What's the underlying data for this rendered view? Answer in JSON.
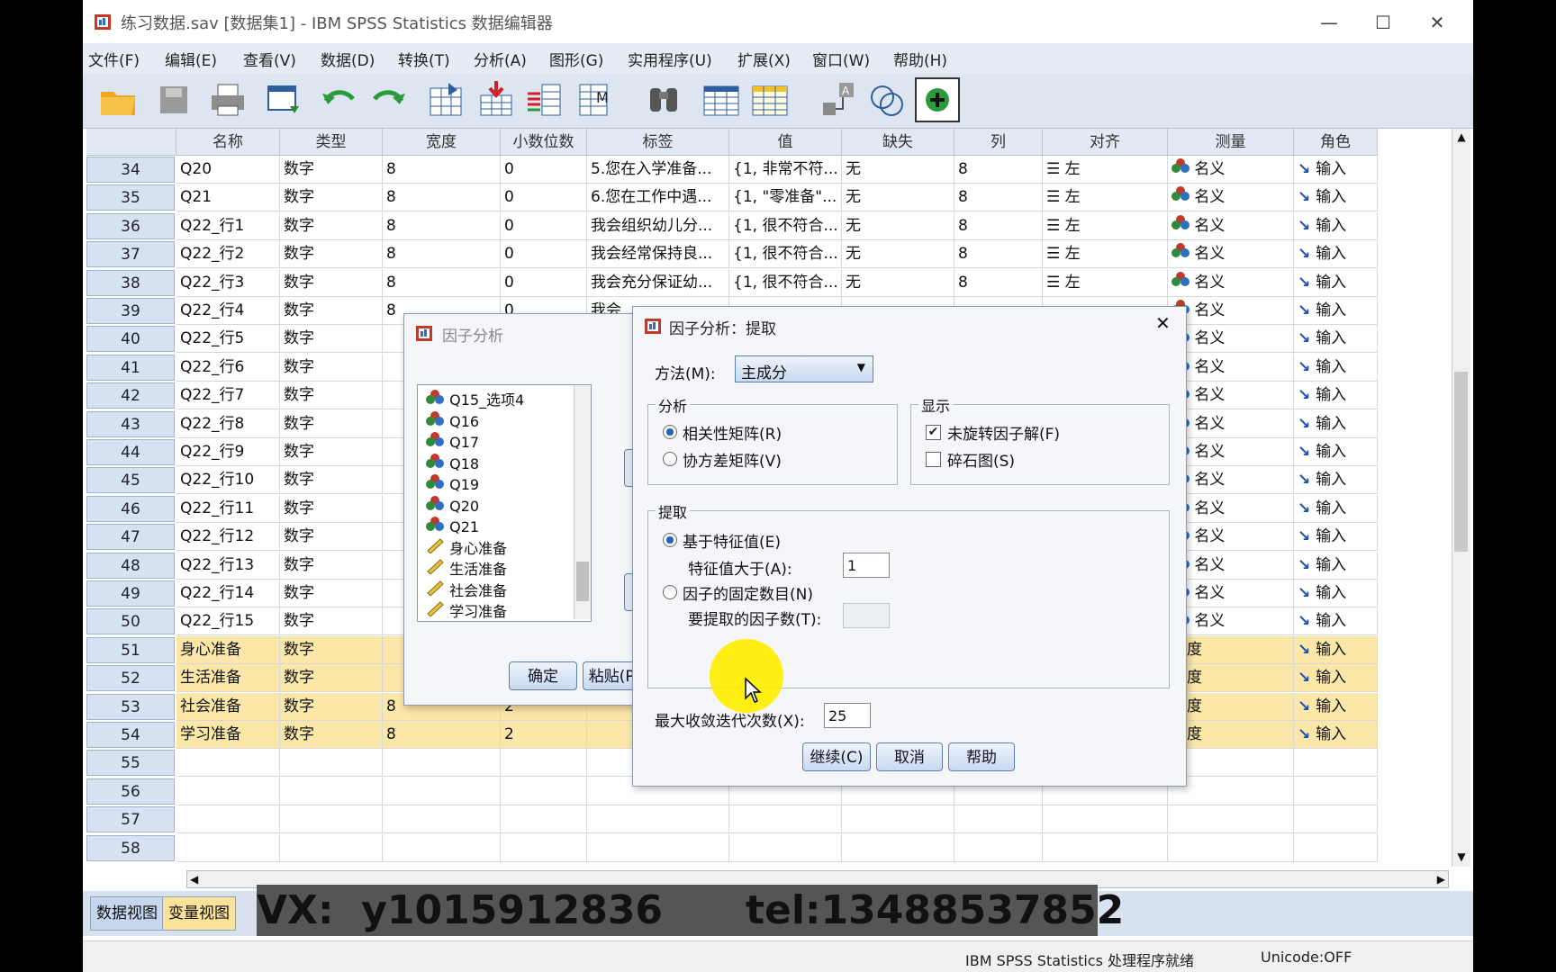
{
  "window": {
    "title": "练习数据.sav [数据集1] - IBM SPSS Statistics 数据编辑器",
    "controls": [
      "—",
      "☐",
      "✕"
    ]
  },
  "menu": [
    "文件(F)",
    "编辑(E)",
    "查看(V)",
    "数据(D)",
    "转换(T)",
    "分析(A)",
    "图形(G)",
    "实用程序(U)",
    "扩展(X)",
    "窗口(W)",
    "帮助(H)"
  ],
  "toolbar": [
    "open-icon",
    "save-icon",
    "print-icon",
    "recall-dialog-icon",
    "undo-icon",
    "redo-icon",
    "goto-case-icon",
    "goto-variable-icon",
    "variables-icon",
    "value-labels-icon",
    "find-icon",
    "insert-cases-icon",
    "insert-variable-icon",
    "split-file-icon",
    "weight-cases-icon",
    "use-sets-icon"
  ],
  "grid": {
    "headers": [
      "名称",
      "类型",
      "宽度",
      "小数位数",
      "标签",
      "值",
      "缺失",
      "列",
      "对齐",
      "测量",
      "角色"
    ],
    "rows": [
      {
        "n": "34",
        "name": "Q20",
        "type": "数字",
        "width": "8",
        "dec": "0",
        "label": "5.您在入学准备...",
        "values": "{1, 非常不符...",
        "missing": "无",
        "cols": "8",
        "align": "左",
        "measure": "名义",
        "role": "输入",
        "hl": false
      },
      {
        "n": "35",
        "name": "Q21",
        "type": "数字",
        "width": "8",
        "dec": "0",
        "label": "6.您在工作中遇...",
        "values": "{1, \"零准备\"...",
        "missing": "无",
        "cols": "8",
        "align": "左",
        "measure": "名义",
        "role": "输入",
        "hl": false
      },
      {
        "n": "36",
        "name": "Q22_行1",
        "type": "数字",
        "width": "8",
        "dec": "0",
        "label": "我会组织幼儿分...",
        "values": "{1, 很不符合...",
        "missing": "无",
        "cols": "8",
        "align": "左",
        "measure": "名义",
        "role": "输入",
        "hl": false
      },
      {
        "n": "37",
        "name": "Q22_行2",
        "type": "数字",
        "width": "8",
        "dec": "0",
        "label": "我会经常保持良...",
        "values": "{1, 很不符合...",
        "missing": "无",
        "cols": "8",
        "align": "左",
        "measure": "名义",
        "role": "输入",
        "hl": false
      },
      {
        "n": "38",
        "name": "Q22_行3",
        "type": "数字",
        "width": "8",
        "dec": "0",
        "label": "我会充分保证幼...",
        "values": "{1, 很不符合...",
        "missing": "无",
        "cols": "8",
        "align": "左",
        "measure": "名义",
        "role": "输入",
        "hl": false
      },
      {
        "n": "39",
        "name": "Q22_行4",
        "type": "数字",
        "width": "8",
        "dec": "0",
        "label": "我会",
        "values": "",
        "missing": "",
        "cols": "",
        "align": "",
        "measure": "名义",
        "role": "输入",
        "hl": false
      },
      {
        "n": "40",
        "name": "Q22_行5",
        "type": "数字",
        "width": "",
        "dec": "",
        "label": "",
        "values": "",
        "missing": "",
        "cols": "",
        "align": "",
        "measure": "名义",
        "role": "输入",
        "hl": false
      },
      {
        "n": "41",
        "name": "Q22_行6",
        "type": "数字",
        "width": "",
        "dec": "",
        "label": "",
        "values": "",
        "missing": "",
        "cols": "",
        "align": "",
        "measure": "名义",
        "role": "输入",
        "hl": false
      },
      {
        "n": "42",
        "name": "Q22_行7",
        "type": "数字",
        "width": "",
        "dec": "",
        "label": "",
        "values": "",
        "missing": "",
        "cols": "",
        "align": "",
        "measure": "名义",
        "role": "输入",
        "hl": false
      },
      {
        "n": "43",
        "name": "Q22_行8",
        "type": "数字",
        "width": "",
        "dec": "",
        "label": "",
        "values": "",
        "missing": "",
        "cols": "",
        "align": "",
        "measure": "名义",
        "role": "输入",
        "hl": false
      },
      {
        "n": "44",
        "name": "Q22_行9",
        "type": "数字",
        "width": "",
        "dec": "",
        "label": "",
        "values": "",
        "missing": "",
        "cols": "",
        "align": "",
        "measure": "名义",
        "role": "输入",
        "hl": false
      },
      {
        "n": "45",
        "name": "Q22_行10",
        "type": "数字",
        "width": "",
        "dec": "",
        "label": "",
        "values": "",
        "missing": "",
        "cols": "",
        "align": "",
        "measure": "名义",
        "role": "输入",
        "hl": false
      },
      {
        "n": "46",
        "name": "Q22_行11",
        "type": "数字",
        "width": "",
        "dec": "",
        "label": "",
        "values": "",
        "missing": "",
        "cols": "",
        "align": "",
        "measure": "名义",
        "role": "输入",
        "hl": false
      },
      {
        "n": "47",
        "name": "Q22_行12",
        "type": "数字",
        "width": "",
        "dec": "",
        "label": "",
        "values": "",
        "missing": "",
        "cols": "",
        "align": "",
        "measure": "名义",
        "role": "输入",
        "hl": false
      },
      {
        "n": "48",
        "name": "Q22_行13",
        "type": "数字",
        "width": "",
        "dec": "",
        "label": "",
        "values": "",
        "missing": "",
        "cols": "",
        "align": "",
        "measure": "名义",
        "role": "输入",
        "hl": false
      },
      {
        "n": "49",
        "name": "Q22_行14",
        "type": "数字",
        "width": "",
        "dec": "",
        "label": "",
        "values": "",
        "missing": "",
        "cols": "",
        "align": "",
        "measure": "名义",
        "role": "输入",
        "hl": false
      },
      {
        "n": "50",
        "name": "Q22_行15",
        "type": "数字",
        "width": "",
        "dec": "",
        "label": "",
        "values": "",
        "missing": "",
        "cols": "",
        "align": "",
        "measure": "名义",
        "role": "输入",
        "hl": false
      },
      {
        "n": "51",
        "name": "身心准备",
        "type": "数字",
        "width": "",
        "dec": "",
        "label": "",
        "values": "",
        "missing": "",
        "cols": "",
        "align": "",
        "measure": "标度",
        "role": "输入",
        "hl": true
      },
      {
        "n": "52",
        "name": "生活准备",
        "type": "数字",
        "width": "",
        "dec": "",
        "label": "",
        "values": "",
        "missing": "",
        "cols": "",
        "align": "",
        "measure": "标度",
        "role": "输入",
        "hl": true
      },
      {
        "n": "53",
        "name": "社会准备",
        "type": "数字",
        "width": "8",
        "dec": "2",
        "label": "",
        "values": "",
        "missing": "",
        "cols": "",
        "align": "",
        "measure": "标度",
        "role": "输入",
        "hl": true
      },
      {
        "n": "54",
        "name": "学习准备",
        "type": "数字",
        "width": "8",
        "dec": "2",
        "label": "",
        "values": "",
        "missing": "",
        "cols": "",
        "align": "",
        "measure": "标度",
        "role": "输入",
        "hl": true
      },
      {
        "n": "55",
        "name": "",
        "type": "",
        "width": "",
        "dec": "",
        "label": "",
        "values": "",
        "missing": "",
        "cols": "",
        "align": "",
        "measure": "",
        "role": "",
        "hl": false
      },
      {
        "n": "56",
        "name": "",
        "type": "",
        "width": "",
        "dec": "",
        "label": "",
        "values": "",
        "missing": "",
        "cols": "",
        "align": "",
        "measure": "",
        "role": "",
        "hl": false
      },
      {
        "n": "57",
        "name": "",
        "type": "",
        "width": "",
        "dec": "",
        "label": "",
        "values": "",
        "missing": "",
        "cols": "",
        "align": "",
        "measure": "",
        "role": "",
        "hl": false
      },
      {
        "n": "58",
        "name": "",
        "type": "",
        "width": "",
        "dec": "",
        "label": "",
        "values": "",
        "missing": "",
        "cols": "",
        "align": "",
        "measure": "",
        "role": "",
        "hl": false
      }
    ]
  },
  "tabs": {
    "data_view": "数据视图",
    "variable_view": "变量视图"
  },
  "watermark": "VX:  y1015912836      tel:13488537852",
  "status": {
    "processor": "IBM SPSS Statistics 处理程序就绪",
    "unicode": "Unicode:OFF"
  },
  "factor_dialog": {
    "title": "因子分析",
    "list": [
      {
        "label": "Q15_选项4",
        "kind": "nominal"
      },
      {
        "label": "Q16",
        "kind": "nominal"
      },
      {
        "label": "Q17",
        "kind": "nominal"
      },
      {
        "label": "Q18",
        "kind": "nominal"
      },
      {
        "label": "Q19",
        "kind": "nominal"
      },
      {
        "label": "Q20",
        "kind": "nominal"
      },
      {
        "label": "Q21",
        "kind": "nominal"
      },
      {
        "label": "身心准备",
        "kind": "scale"
      },
      {
        "label": "生活准备",
        "kind": "scale"
      },
      {
        "label": "社会准备",
        "kind": "scale"
      },
      {
        "label": "学习准备",
        "kind": "scale"
      }
    ],
    "ok": "确定",
    "paste": "粘贴(P)"
  },
  "extract_dialog": {
    "title": "因子分析：提取",
    "method_label": "方法(M):",
    "method_value": "主成分",
    "analysis_group": "分析",
    "corr_matrix": "相关性矩阵(R)",
    "cov_matrix": "协方差矩阵(V)",
    "display_group": "显示",
    "unrotated": "未旋转因子解(F)",
    "scree": "碎石图(S)",
    "extract_group": "提取",
    "by_eigen": "基于特征值(E)",
    "eigen_gt": "特征值大于(A):",
    "eigen_value": "1",
    "fixed_number": "因子的固定数目(N)",
    "factors_to_extract": "要提取的因子数(T):",
    "max_iter_label": "最大收敛迭代次数(X):",
    "max_iter_value": "25",
    "continue": "继续(C)",
    "cancel": "取消",
    "help": "帮助",
    "close": "✕"
  }
}
